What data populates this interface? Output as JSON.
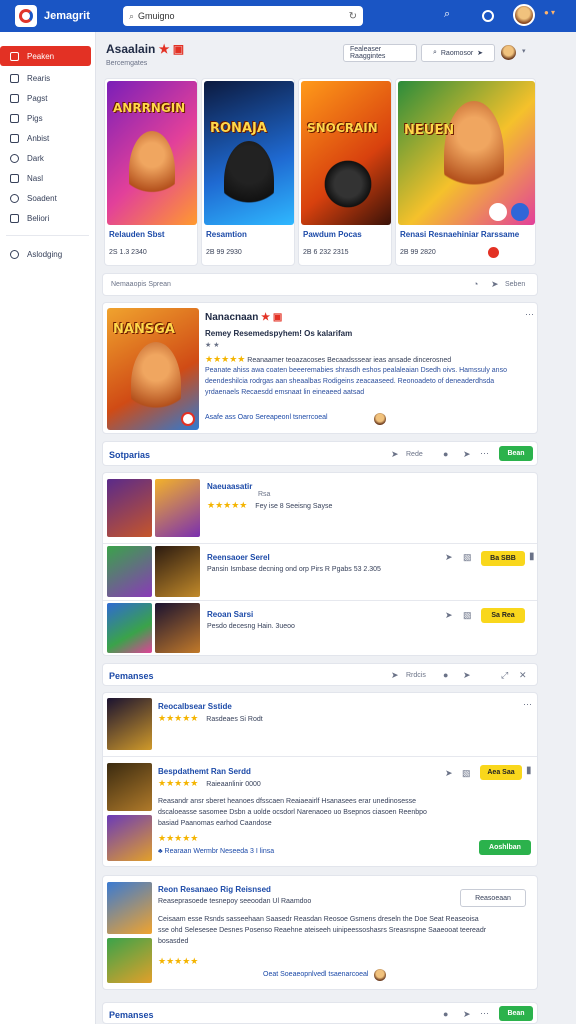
{
  "app": {
    "brand": "Jemagrit"
  },
  "search": {
    "value": "Gmuigno",
    "placeholder": "Search"
  },
  "sidebar": {
    "items": [
      {
        "label": "Peaken",
        "icon": "home-icon"
      },
      {
        "label": "Rearis",
        "icon": "grid-icon"
      },
      {
        "label": "Pagst",
        "icon": "chart-icon"
      },
      {
        "label": "Pigs",
        "icon": "tag-icon"
      },
      {
        "label": "Anbist",
        "icon": "user-icon"
      },
      {
        "label": "Dark",
        "icon": "clock-icon"
      },
      {
        "label": "Nasl",
        "icon": "list-icon"
      },
      {
        "label": "Soadent",
        "icon": "settings-icon"
      },
      {
        "label": "Beliori",
        "icon": "book-icon"
      },
      {
        "label": "Aslodging",
        "icon": "help-icon"
      }
    ]
  },
  "header": {
    "title": "Asaalain",
    "subtitle": "Bercemgates",
    "filter_label": "Fealeaser Raaggintes",
    "create_label": "Raomosor"
  },
  "featured": [
    {
      "art_text": "ANRRNGIN",
      "title": "Relauden Sbst",
      "meta": "2S 1.3 2340"
    },
    {
      "art_text": "RONAJA",
      "title": "Resamtion",
      "meta": "2B 99 2930"
    },
    {
      "art_text": "SNOCRAIN",
      "title": "Pawdum Pocas",
      "meta": "2B 6 232 2315"
    },
    {
      "art_text": "NEUEN",
      "title": "Renasi Resnaehiniar Rarssame",
      "meta": "2B 99 2820"
    }
  ],
  "filter_bar": {
    "label": "Nemaaopis Sprean",
    "action": "Seben"
  },
  "hero": {
    "art_text": "NANSGA",
    "title": "Nanacnaan",
    "subtitle": "Remey Resemedspyhem! Os kalarifam",
    "rating_label": "Reanaamer teoazacoses Becaadsssear ieas ansade dincerosned",
    "body": "Peanate ahiss awa coaten beeeremabies shrasdh eshos pealaleaian Dsedh oivs. Hamssuly anso deendeshilcia rodrgas aan sheaalbas Rodigeins zeacaaseed. Reonoadeto of deneaderdhsda yrdaenaels Recaesdd emsnaat lin eineaeed aatsad",
    "footer": "Asafe ass  Oaro Sereapeonl tsnerrcoeal"
  },
  "section1": {
    "title": "Sotparias",
    "action": "Rede",
    "add": "Bean"
  },
  "list1": [
    {
      "title": "Naeuaasatir",
      "stars": "★★★★★",
      "meta": "Fey ise 8 Seeisng Sayse",
      "tag": "Rsa"
    },
    {
      "title": "Reensaoer Serel",
      "meta": "Pansin Ismbase decning ond orp Pirs R Pgabs 53 2.305",
      "btn": "Ba SBB"
    },
    {
      "title": "Reoan Sarsi",
      "meta": "Pesdo decesng Hain. 3ueoo",
      "btn": "Sa Rea"
    }
  ],
  "section2": {
    "title": "Pemanses",
    "action": "Rrdcis"
  },
  "list2": [
    {
      "title": "Reocalbsear Sstide",
      "meta": "Rasdeaes Si Rodt",
      "stars": "★★★★★"
    },
    {
      "title": "Bespdathemt Ran Serdd",
      "meta": "Raieaanlinir 0000",
      "stars": "★★★★★",
      "btn": "Aea Saa",
      "body": "Reasandr ansr sberet heanoes dfsscaen Reaiaeairlf Hsanasees erar unedinosesse dscaloeasse sasomee Dsbn a uolde ocsdorl Narenaoeo uo Bsepnos ciasoen Reenbpo basiad Paanomas earhod Caandose",
      "footer": "Rearaan Wermbr Neseeda 3 I linsa",
      "green": "Aoshlban"
    }
  ],
  "section3": {
    "title": "Reon Resanaeo Rig Reisnsed",
    "sub": "Reaseprasoede tesnepoy seeoodan  Ul Raamdoo",
    "btn": "Reasoeaan",
    "body": "Ceisaam esse Rsnds sasseehaan Saasedr Reasdan Reosoe Gsmens dreseln the Doe Seat Reaseoisa sse ohd Selesesee Desnes Posenso Reaehne ateiseeh uinipeessoshasrs Sreasnspne Saaeooat teereadr bosasded",
    "footer": "Oeat Soeaeopnlvedl tsaenarcoeal",
    "stars": "★★★★★"
  },
  "section4": {
    "title": "Pemanses",
    "add": "Bean"
  },
  "colors": {
    "accent": "#1a55c4",
    "active": "#e33124",
    "primary_btn": "#2bb24c",
    "secondary_btn": "#f9d71c"
  }
}
